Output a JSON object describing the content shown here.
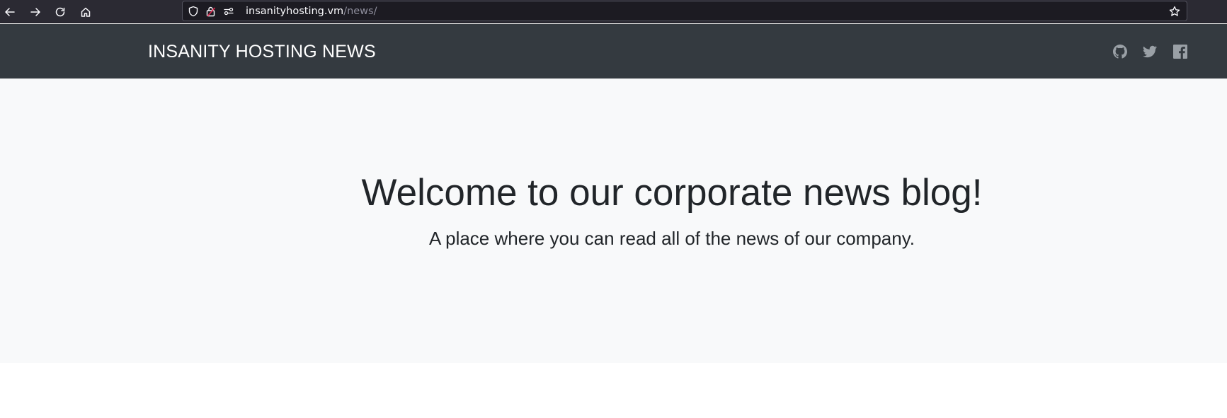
{
  "browser": {
    "url_host": "insanityhosting.vm",
    "url_path": "/news/",
    "icons": [
      "back-icon",
      "forward-icon",
      "reload-icon",
      "home-icon",
      "shield-icon",
      "lock-warning-icon",
      "permissions-icon",
      "bookmark-star-icon"
    ]
  },
  "navbar": {
    "brand": "INSANITY HOSTING NEWS",
    "social_icons": [
      "github-icon",
      "twitter-icon",
      "facebook-icon"
    ],
    "background": "#343a40"
  },
  "hero": {
    "title": "Welcome to our corporate news blog!",
    "subtitle": "A place where you can read all of the news of our company.",
    "background": "#f8f9fa"
  }
}
